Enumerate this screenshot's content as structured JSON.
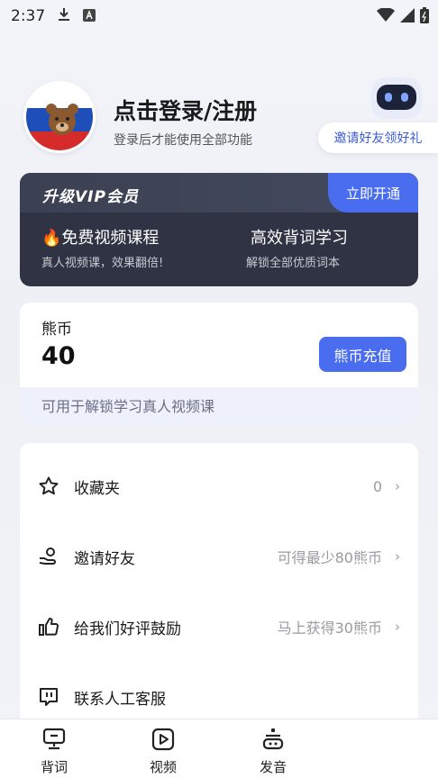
{
  "status_bar": {
    "time": "2:37"
  },
  "profile": {
    "login_title": "点击登录/注册",
    "login_subtitle": "登录后才能使用全部功能",
    "invite_badge": "邀请好友领好礼"
  },
  "vip": {
    "title": "升级VIP会员",
    "open_button": "立即开通",
    "features": [
      {
        "title": "🔥免费视频课程",
        "subtitle": "真人视频课，效果翻倍!"
      },
      {
        "title": "高效背词学习",
        "subtitle": "解锁全部优质词本"
      }
    ]
  },
  "coins": {
    "label": "熊币",
    "value": "40",
    "recharge_button": "熊币充值",
    "note": "可用于解锁学习真人视频课"
  },
  "menu": [
    {
      "label": "收藏夹",
      "value": "0",
      "icon": "star-icon"
    },
    {
      "label": "邀请好友",
      "value": "可得最少80熊币",
      "icon": "hand-icon"
    },
    {
      "label": "给我们好评鼓励",
      "value": "马上获得30熊币",
      "icon": "thumbs-up-icon"
    },
    {
      "label": "联系人工客服",
      "value": "",
      "icon": "chat-icon"
    }
  ],
  "tabs": [
    {
      "label": "背词",
      "icon": "vocabulary-icon"
    },
    {
      "label": "视频",
      "icon": "video-play-icon"
    },
    {
      "label": "发音",
      "icon": "pronunciation-icon"
    }
  ],
  "colors": {
    "accent": "#4a6df0",
    "vip_bg": "#2f3344",
    "note_bg": "#eef0fb"
  }
}
